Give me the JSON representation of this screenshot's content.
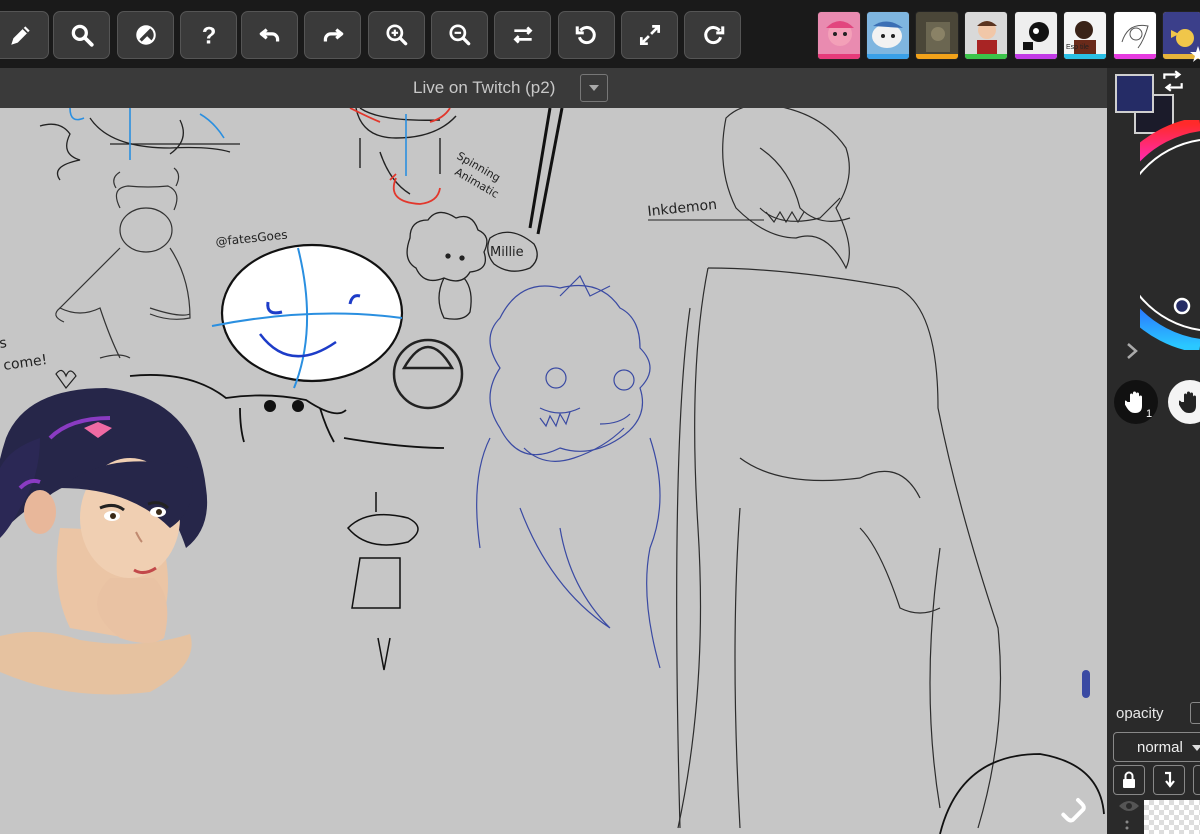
{
  "room": {
    "title": "Live on Twitch (p2)"
  },
  "toolbar": {
    "tools": [
      {
        "name": "pencil-button",
        "icon": "pencil-icon"
      },
      {
        "name": "search-button",
        "icon": "magnifier-icon"
      },
      {
        "name": "eraser-button",
        "icon": "eraser-icon"
      },
      {
        "name": "help-button",
        "icon": "question-icon"
      },
      {
        "name": "undo-button",
        "icon": "undo-icon"
      },
      {
        "name": "redo-button",
        "icon": "redo-icon"
      },
      {
        "name": "zoom-in-button",
        "icon": "zoom-in-icon"
      },
      {
        "name": "zoom-out-button",
        "icon": "zoom-out-icon"
      },
      {
        "name": "flip-button",
        "icon": "swap-arrows-icon"
      },
      {
        "name": "rotate-left-button",
        "icon": "rotate-left-icon"
      },
      {
        "name": "fullscreen-button",
        "icon": "expand-icon"
      },
      {
        "name": "rotate-right-button",
        "icon": "rotate-right-icon"
      }
    ]
  },
  "users": [
    {
      "name": "user-avatar-1",
      "bar_color": "#e63b7a"
    },
    {
      "name": "user-avatar-2",
      "bar_color": "#3aa0e8"
    },
    {
      "name": "user-avatar-3",
      "bar_color": "#f2a21a"
    },
    {
      "name": "user-avatar-4",
      "bar_color": "#3cc44a"
    },
    {
      "name": "user-avatar-5",
      "bar_color": "#c23be6"
    },
    {
      "name": "user-avatar-6",
      "bar_color": "#2ac0e6",
      "label": "Esp tile"
    },
    {
      "name": "user-avatar-7",
      "bar_color": "#e63be0"
    },
    {
      "name": "user-avatar-8",
      "bar_color": "#e6b43b"
    }
  ],
  "canvas_text": {
    "signature": "@fatesGoes",
    "spinning": "Spinning",
    "animatic": "Animatic",
    "millie": "Millie",
    "inkdemon": "Inkdemon",
    "come": "s",
    "come2": "come!"
  },
  "colors": {
    "foreground": "#252c66",
    "background": "#1b1b2a"
  },
  "hand_tools": [
    {
      "name": "hand-tool-1",
      "badge": "1"
    },
    {
      "name": "hand-tool-2",
      "badge": ""
    }
  ],
  "layers": {
    "opacity_label": "opacity",
    "blend_mode": "normal"
  }
}
